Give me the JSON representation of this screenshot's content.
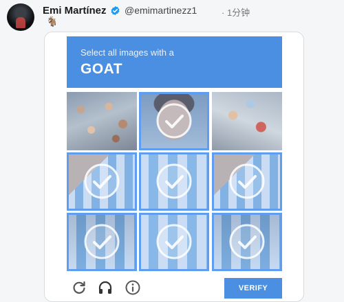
{
  "post": {
    "author_name": "Emi Martínez",
    "author_handle": "@emimartinezz1",
    "time": "· 1分钟",
    "emoji": "🐐"
  },
  "captcha": {
    "instruction": "Select all images with a",
    "target": "GOAT",
    "grid": {
      "rows": 3,
      "cols": 3,
      "tiles": [
        {
          "selected": false
        },
        {
          "selected": true
        },
        {
          "selected": false
        },
        {
          "selected": true
        },
        {
          "selected": true
        },
        {
          "selected": true
        },
        {
          "selected": true
        },
        {
          "selected": true
        },
        {
          "selected": true
        }
      ]
    },
    "footer": {
      "icons": [
        "reload-icon",
        "audio-icon",
        "info-icon"
      ],
      "verify_label": "VERIFY"
    }
  },
  "colors": {
    "accent": "#4a8fe2",
    "selected_border": "#5f9df0",
    "verified_badge": "#1d9bf0"
  }
}
